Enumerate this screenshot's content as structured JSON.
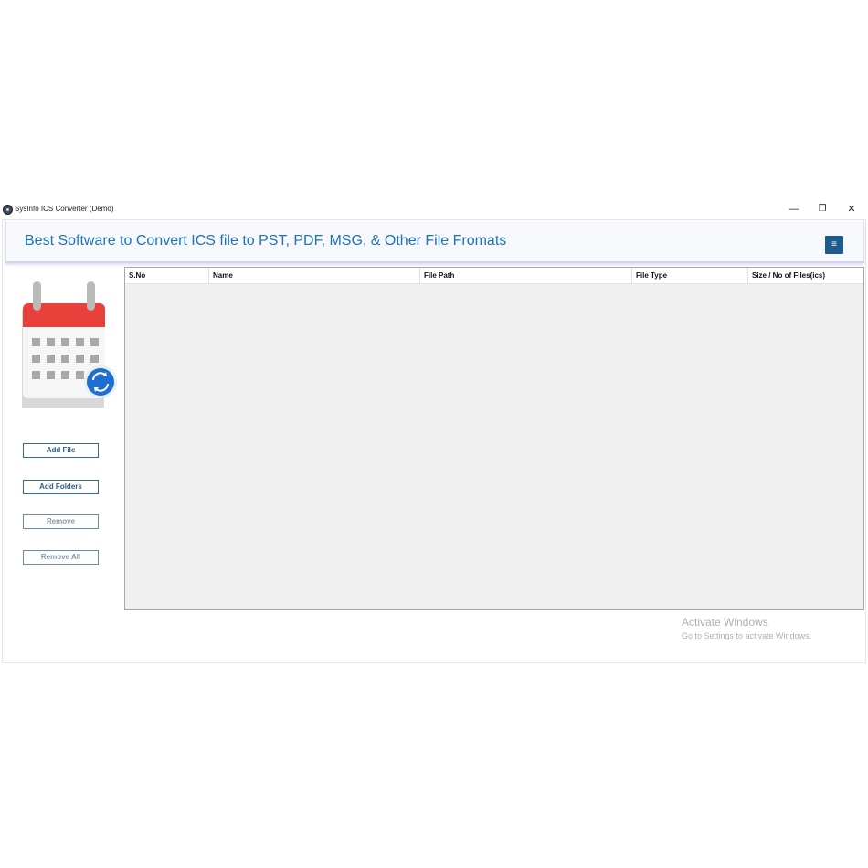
{
  "window": {
    "title": "SysInfo ICS Converter (Demo)",
    "controls": {
      "minimize": "—",
      "restore": "❐",
      "close": "✕"
    }
  },
  "banner": {
    "title": "Best Software to Convert ICS file to PST, PDF, MSG, & Other File Fromats",
    "menu_icon": "≡"
  },
  "logo": {
    "icon": "calendar-sync-icon",
    "colors": {
      "header": "#e8413b",
      "sync": "#1f6fd1"
    }
  },
  "sidebar": {
    "add_file": "Add File",
    "add_folders": "Add Folders",
    "remove": "Remove",
    "remove_all": "Remove All"
  },
  "table": {
    "columns": [
      "S.No",
      "Name",
      "File Path",
      "File Type",
      "Size / No of Files(ics)"
    ]
  },
  "watermark": {
    "title": "Activate Windows",
    "subtitle": "Go to Settings to activate Windows."
  },
  "colors": {
    "accent": "#1e73b8",
    "menu_button": "#1d5b8c"
  }
}
